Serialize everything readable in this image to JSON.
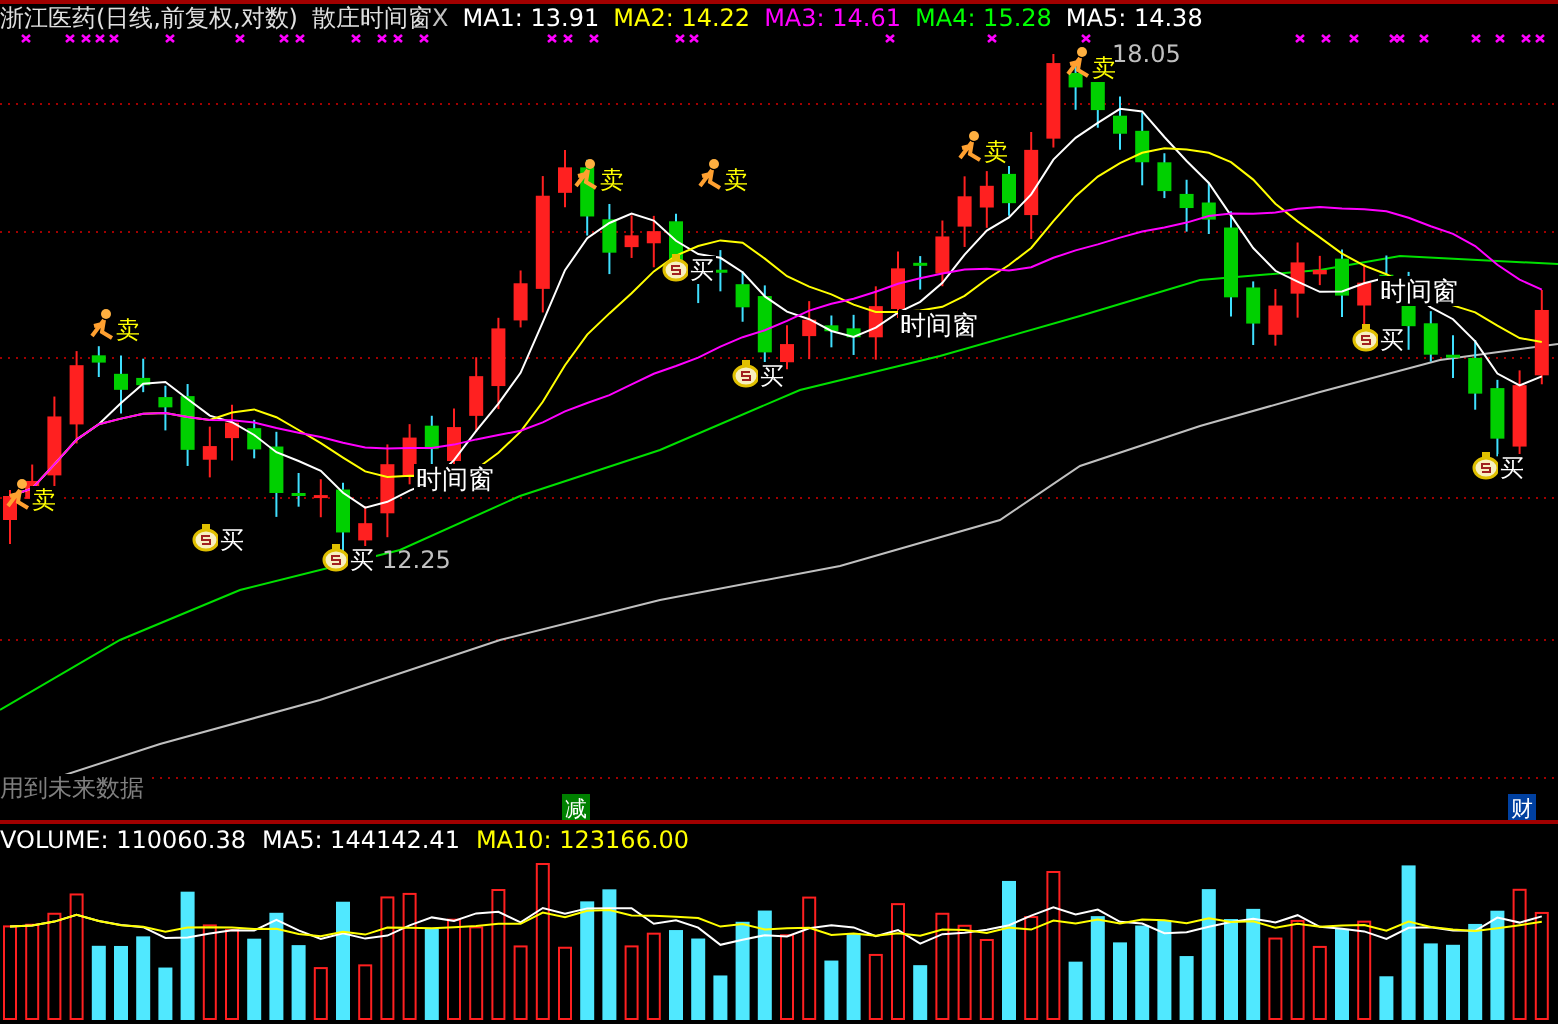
{
  "header": {
    "title": "浙江医药(日线,前复权,对数)",
    "indicator": "散庄时间窗",
    "close": "X",
    "ma_values": [
      {
        "label": "MA1:",
        "value": "13.91",
        "color": "#ffffff"
      },
      {
        "label": "MA2:",
        "value": "14.22",
        "color": "#ffff00"
      },
      {
        "label": "MA3:",
        "value": "14.61",
        "color": "#ff00ff"
      },
      {
        "label": "MA4:",
        "value": "15.28",
        "color": "#00ff00"
      },
      {
        "label": "MA5:",
        "value": "14.38",
        "color": "#ffffff"
      }
    ]
  },
  "chart": {
    "signals": [
      {
        "kind": "sell",
        "text": "卖"
      },
      {
        "kind": "sell",
        "text": "卖"
      },
      {
        "kind": "sell",
        "text": "卖"
      },
      {
        "kind": "sell",
        "text": "卖"
      },
      {
        "kind": "sell",
        "text": "卖"
      },
      {
        "kind": "sell",
        "text": "卖"
      },
      {
        "kind": "buy",
        "text": "买"
      },
      {
        "kind": "buy",
        "text": "买"
      },
      {
        "kind": "buy",
        "text": "买"
      },
      {
        "kind": "buy",
        "text": "买"
      },
      {
        "kind": "buy",
        "text": "买"
      },
      {
        "kind": "buy",
        "text": "买"
      }
    ],
    "price_labels": [
      "12.25",
      "18.05"
    ],
    "time_windows": [
      "时间窗",
      "时间窗",
      "时间窗"
    ],
    "note": "用到未来数据",
    "badges": [
      {
        "text": "减",
        "color": "#008000"
      },
      {
        "text": "财",
        "color": "#0040a0"
      }
    ]
  },
  "volume": {
    "items": [
      {
        "label": "VOLUME:",
        "value": "110060.38",
        "color": "#ffffff"
      },
      {
        "label": "MA5:",
        "value": "144142.41",
        "color": "#ffffff"
      },
      {
        "label": "MA10:",
        "value": "123166.00",
        "color": "#ffff00"
      }
    ]
  }
}
